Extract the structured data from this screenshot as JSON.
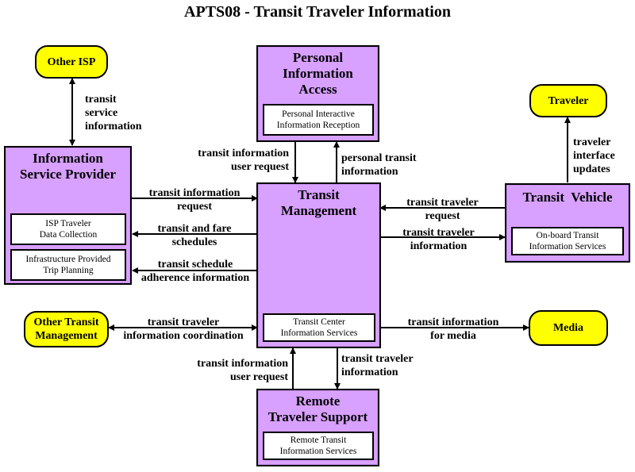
{
  "title": "APTS08 - Transit Traveler Information",
  "subsystems": {
    "pia": {
      "title": [
        "Personal",
        "Information",
        "Access"
      ],
      "element": [
        "Personal Interactive",
        "Information Reception"
      ]
    },
    "isp": {
      "title": [
        "Information",
        "Service Provider"
      ],
      "elements": [
        [
          "ISP Traveler",
          "Data Collection"
        ],
        [
          "Infrastructure Provided",
          "Trip Planning"
        ]
      ]
    },
    "tm": {
      "title": [
        "Transit",
        "Management"
      ],
      "element": [
        "Transit Center",
        "Information Services"
      ]
    },
    "tv": {
      "title": [
        "Transit  Vehicle"
      ],
      "element": [
        "On-board Transit",
        "Information Services"
      ]
    },
    "rts": {
      "title": [
        "Remote",
        "Traveler Support"
      ],
      "element": [
        "Remote Transit",
        "Information Services"
      ]
    }
  },
  "terminators": {
    "other_isp": [
      "Other ISP"
    ],
    "traveler": [
      "Traveler"
    ],
    "other_tm": [
      "Other Transit",
      "Management"
    ],
    "media": [
      "Media"
    ]
  },
  "flows": {
    "transit_service_information": [
      "transit",
      "service",
      "information"
    ],
    "pia_user_request": [
      "transit information",
      "user request"
    ],
    "personal_transit_information": [
      "personal transit",
      "information"
    ],
    "traveler_interface_updates": [
      "traveler",
      "interface",
      "updates"
    ],
    "transit_information_request": [
      "transit information",
      "request"
    ],
    "transit_and_fare_schedules": [
      "transit and fare",
      "schedules"
    ],
    "schedule_adherence": [
      "transit schedule",
      "adherence information"
    ],
    "transit_traveler_request": [
      "transit traveler",
      "request"
    ],
    "tv_transit_traveler_information": [
      "transit traveler",
      "information"
    ],
    "info_coordination": [
      "transit traveler",
      "information coordination"
    ],
    "info_for_media": [
      "transit information",
      "for media"
    ],
    "rts_user_request": [
      "transit information",
      "user request"
    ],
    "rts_transit_traveler_information": [
      "transit traveler",
      "information"
    ]
  }
}
